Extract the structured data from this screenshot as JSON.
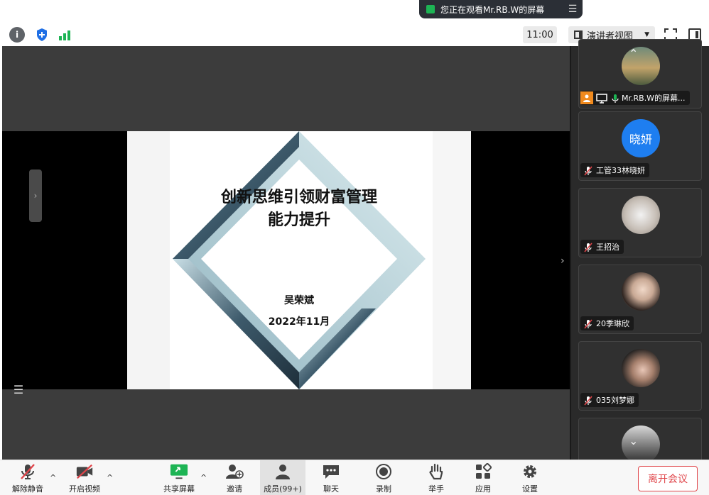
{
  "banner": {
    "text": "您正在观看Mr.RB.W的屏幕",
    "menu_icon": "hamburger-icon"
  },
  "toolbar": {
    "time": "11:00",
    "view_mode": "演讲者视图",
    "icons": [
      "info-icon",
      "shield-icon",
      "signal-icon",
      "fullscreen-icon",
      "sidebar-toggle-icon"
    ]
  },
  "slide": {
    "title_line1": "创新思维引领财富管理",
    "title_line2": "能力提升",
    "author": "吴荣斌",
    "date": "2022年11月"
  },
  "participants": [
    {
      "name": "Mr.RB.W的屏幕...",
      "role": "host",
      "avatar_type": "photo-landscape"
    },
    {
      "name": "工管33林晓妍",
      "avatar_text": "晓妍",
      "avatar_color": "#1e7ef0"
    },
    {
      "name": "王招治",
      "avatar_type": "photo"
    },
    {
      "name": "20季琳欣",
      "avatar_type": "photo"
    },
    {
      "name": "035刘梦娜",
      "avatar_type": "photo"
    }
  ],
  "bottom": {
    "unmute": "解除静音",
    "start_video": "开启视频",
    "share_screen": "共享屏幕",
    "invite": "邀请",
    "members": "成员(99+)",
    "chat": "聊天",
    "record": "录制",
    "raise_hand": "举手",
    "apps": "应用",
    "settings": "设置",
    "leave": "离开会议"
  },
  "colors": {
    "leave": "#e0454a",
    "accent_green": "#1db454",
    "host_orange": "#f08a1e"
  }
}
